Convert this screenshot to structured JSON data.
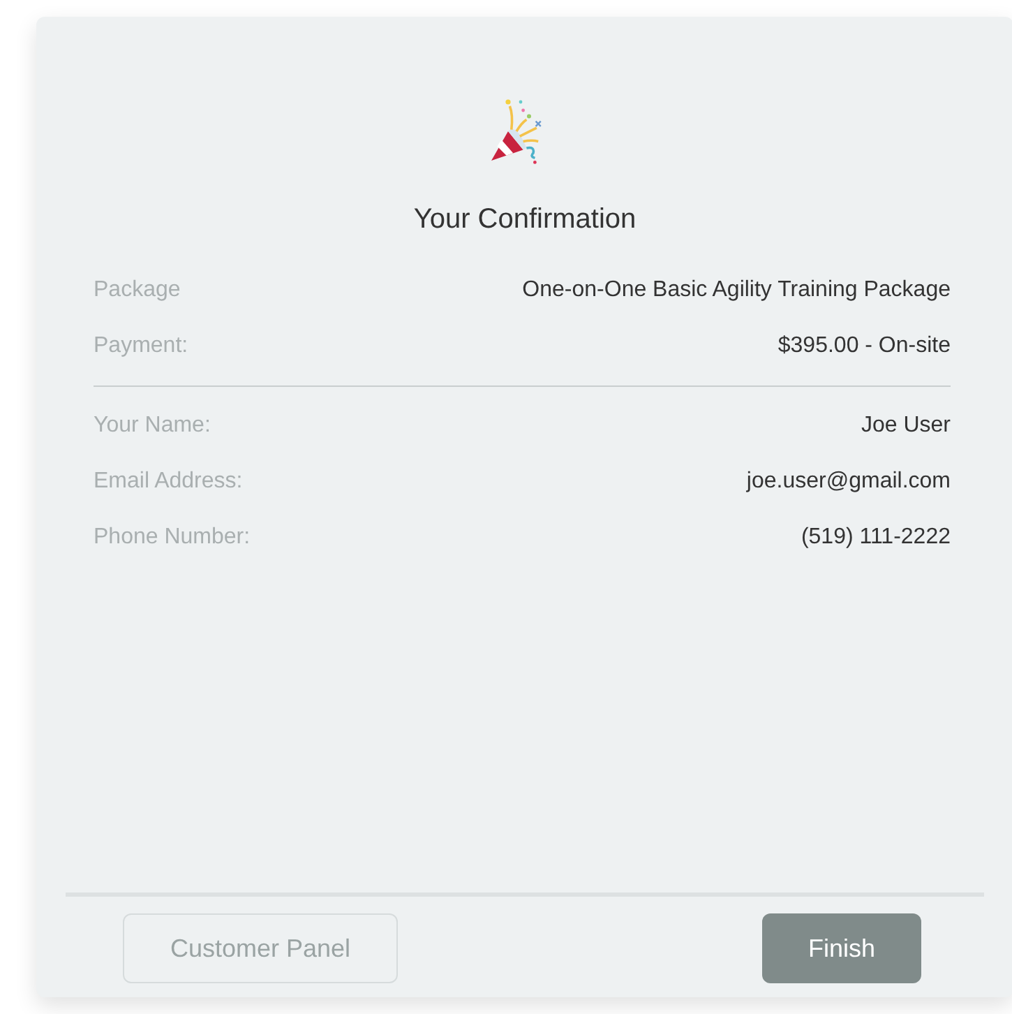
{
  "title": "Your Confirmation",
  "summary": [
    {
      "label": "Package",
      "value": "One-on-One Basic Agility Training Package"
    },
    {
      "label": "Payment:",
      "value": "$395.00 - On-site"
    }
  ],
  "contact": [
    {
      "label": "Your Name:",
      "value": "Joe User"
    },
    {
      "label": "Email Address:",
      "value": "joe.user@gmail.com"
    },
    {
      "label": "Phone Number:",
      "value": "(519) 111-2222"
    }
  ],
  "buttons": [
    {
      "label": "Customer Panel",
      "kind": "secondary"
    },
    {
      "label": "Finish",
      "kind": "primary"
    }
  ]
}
